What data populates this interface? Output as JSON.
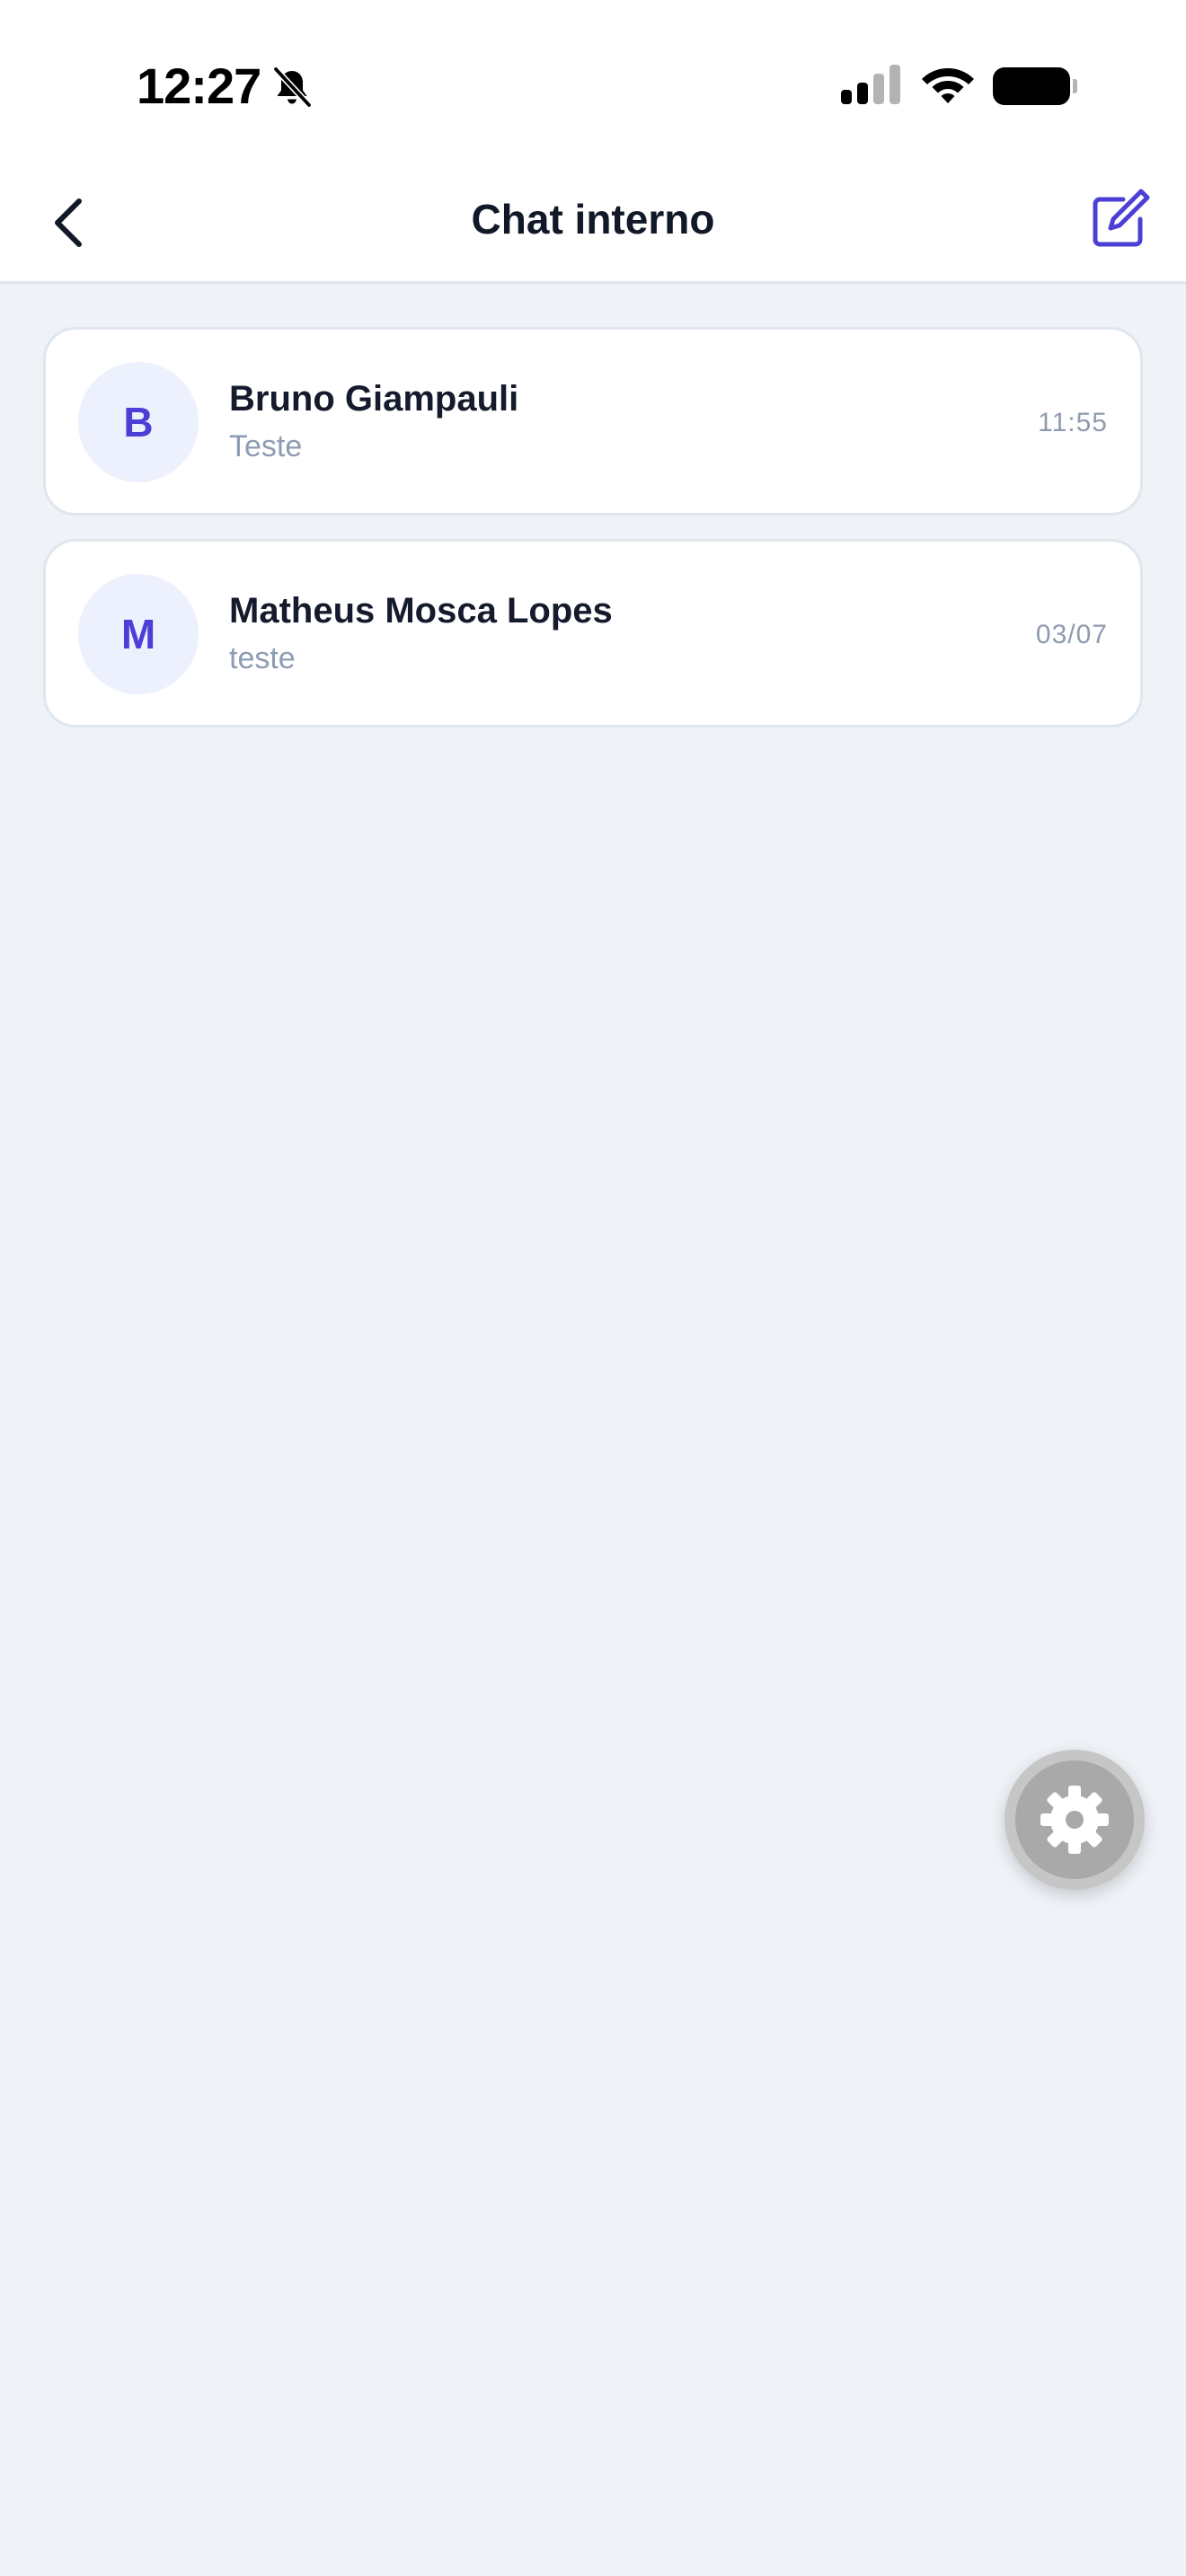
{
  "status_bar": {
    "time": "12:27",
    "icons": [
      "bell-off-icon",
      "signal-icon",
      "wifi-icon",
      "battery-icon"
    ]
  },
  "header": {
    "title": "Chat interno",
    "back_icon": "chevron-left-icon",
    "compose_icon": "compose-icon"
  },
  "chats": [
    {
      "initial": "B",
      "name": "Bruno Giampauli",
      "preview": "Teste",
      "time": "11:55"
    },
    {
      "initial": "M",
      "name": "Matheus Mosca Lopes",
      "preview": "teste",
      "time": "03/07"
    }
  ],
  "fab": {
    "icon": "gear-icon"
  },
  "colors": {
    "accent": "#4b3fd6",
    "background": "#eff3f8",
    "card": "#ffffff",
    "avatar_bg": "#edf0fd",
    "muted_text": "#8d9cb3"
  }
}
